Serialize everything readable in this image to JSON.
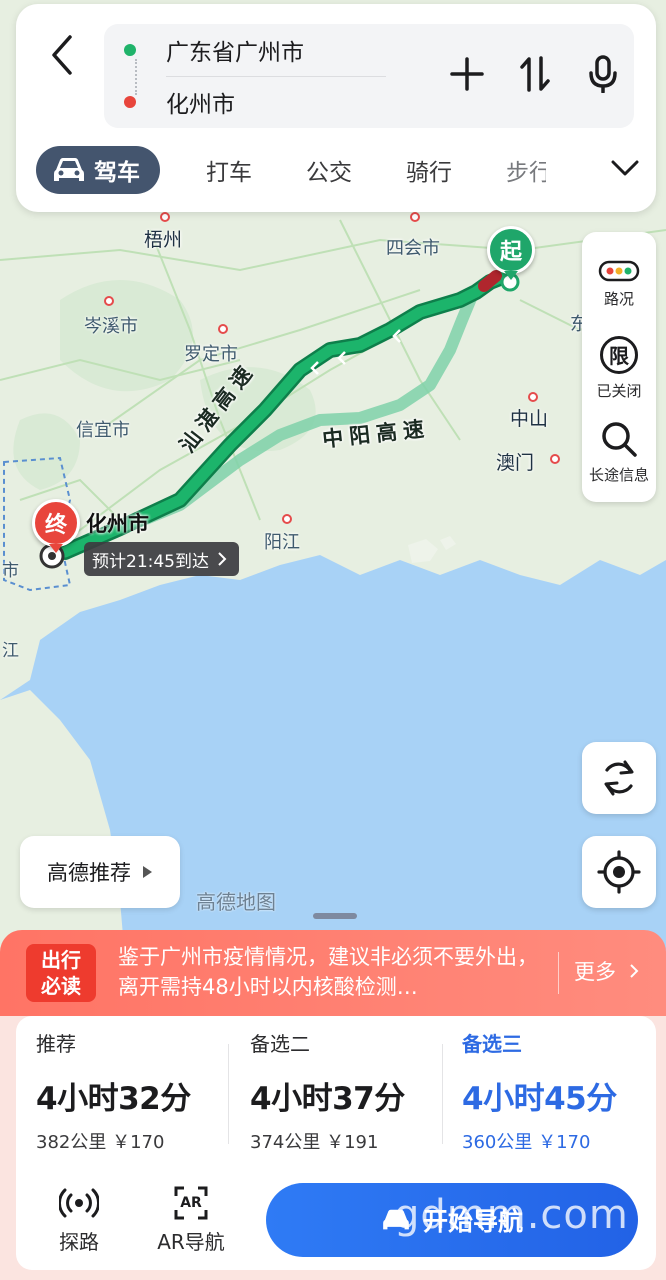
{
  "header": {
    "origin": "广东省广州市",
    "destination": "化州市",
    "actions": [
      "add-stop-icon",
      "swap-icon",
      "microphone-icon"
    ]
  },
  "modes": {
    "items": [
      {
        "label": "驾车",
        "active": true
      },
      {
        "label": "打车",
        "active": false
      },
      {
        "label": "公交",
        "active": false
      },
      {
        "label": "骑行",
        "active": false
      },
      {
        "label": "步行",
        "active": false
      }
    ]
  },
  "map": {
    "cities": {
      "wuzhou": "梧州",
      "sihui": "四会市",
      "cenxi": "岑溪市",
      "luoding": "罗定市",
      "xinyi": "信宜市",
      "zhongshan": "中山",
      "macau": "澳门",
      "yangjiang": "阳江",
      "dong": "东",
      "shi": "市",
      "jiang": "江",
      "huazhou": "化州市"
    },
    "roads": {
      "main": "汕湛高速",
      "alt": "中阳高速"
    },
    "start_pin": "起",
    "end_pin": "终",
    "eta": "预计21:45到达",
    "watermark": "高德地图"
  },
  "side_tools": {
    "traffic": "路况",
    "restriction": "已关闭",
    "restriction_icon_text": "限",
    "long_trip": "长途信息"
  },
  "recommend_chip": "高德推荐",
  "notice": {
    "badge_line1": "出行",
    "badge_line2": "必读",
    "text": "鉴于广州市疫情情况，建议非必须不要外出，离开需持48小时以内核酸检测…",
    "more": "更多"
  },
  "routes": [
    {
      "tag": "推荐",
      "time": "4小时32分",
      "meta": "382公里 ￥170",
      "selected": false
    },
    {
      "tag": "备选二",
      "time": "4小时37分",
      "meta": "374公里 ￥191",
      "selected": false
    },
    {
      "tag": "备选三",
      "time": "4小时45分",
      "meta": "360公里 ￥170",
      "selected": true
    }
  ],
  "bottom_tools": {
    "explore": "探路",
    "ar_nav": "AR导航",
    "ar_icon_text": "AR",
    "start_nav": "开始导航"
  },
  "watermark_site": "gdmm.com",
  "colors": {
    "route_main": "#14a05f",
    "route_alt": "#7fd1a9",
    "accent_blue": "#2d6ae3",
    "notice_red": "#ff7465"
  }
}
